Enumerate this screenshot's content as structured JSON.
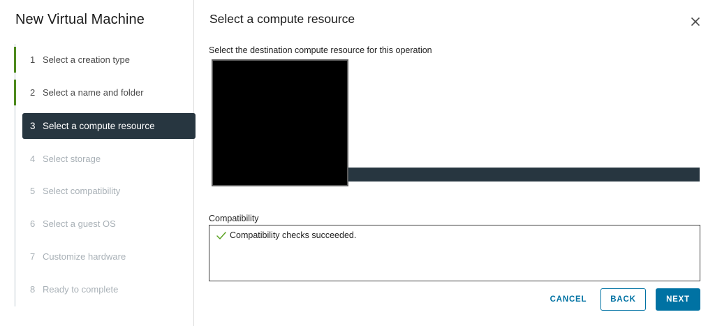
{
  "wizard": {
    "title": "New Virtual Machine",
    "steps": [
      {
        "number": "1",
        "label": "Select a creation type",
        "state": "done"
      },
      {
        "number": "2",
        "label": "Select a name and folder",
        "state": "done"
      },
      {
        "number": "3",
        "label": "Select a compute resource",
        "state": "active"
      },
      {
        "number": "4",
        "label": "Select storage",
        "state": "pending"
      },
      {
        "number": "5",
        "label": "Select compatibility",
        "state": "pending"
      },
      {
        "number": "6",
        "label": "Select a guest OS",
        "state": "pending"
      },
      {
        "number": "7",
        "label": "Customize hardware",
        "state": "pending"
      },
      {
        "number": "8",
        "label": "Ready to complete",
        "state": "pending"
      }
    ]
  },
  "page": {
    "title": "Select a compute resource",
    "instruction": "Select the destination compute resource for this operation",
    "close_icon": "close-icon"
  },
  "compatibility": {
    "label": "Compatibility",
    "message": "Compatibility checks succeeded.",
    "status_icon": "checkmark-icon",
    "status_color": "#5aa220"
  },
  "footer": {
    "cancel_label": "CANCEL",
    "back_label": "BACK",
    "next_label": "NEXT"
  },
  "colors": {
    "accent": "#0072a3",
    "active_step_bg": "#273640",
    "done_step_bar": "#4e8a1d",
    "pending_text": "#a9b1b7"
  }
}
